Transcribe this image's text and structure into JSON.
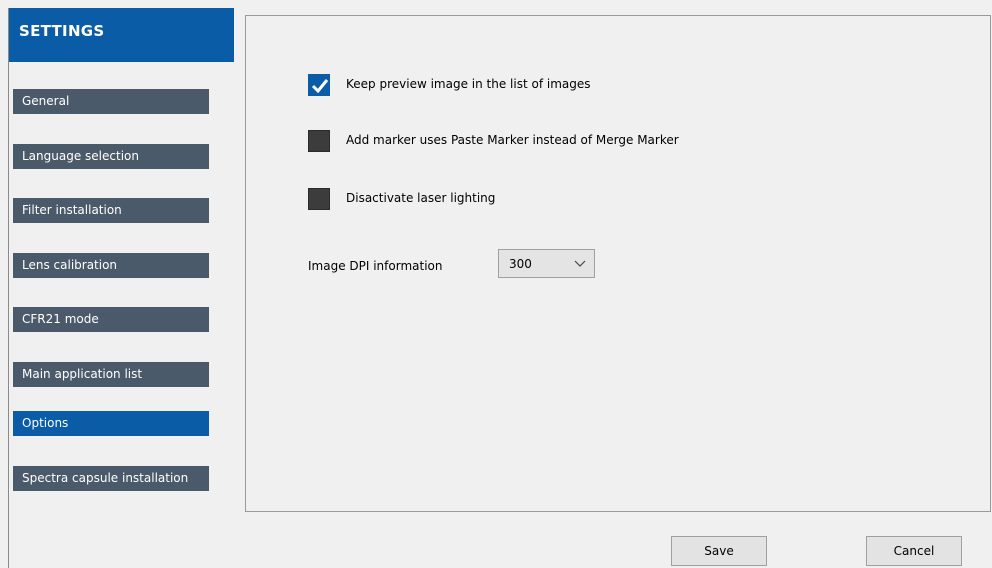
{
  "sidebar": {
    "title": "SETTINGS",
    "items": [
      {
        "label": "General"
      },
      {
        "label": "Language selection"
      },
      {
        "label": "Filter installation"
      },
      {
        "label": "Lens calibration"
      },
      {
        "label": "CFR21 mode"
      },
      {
        "label": "Main application list"
      },
      {
        "label": "Options"
      },
      {
        "label": "Spectra capsule installation"
      }
    ],
    "active_item": "Options"
  },
  "options": {
    "keep_preview": {
      "label": "Keep preview image in the list of images",
      "checked": true
    },
    "paste_marker": {
      "label": "Add marker uses Paste Marker instead of Merge Marker",
      "checked": false
    },
    "disable_laser": {
      "label": "Disactivate laser lighting",
      "checked": false
    },
    "dpi": {
      "label": "Image DPI information",
      "value": "300"
    }
  },
  "footer": {
    "save_label": "Save",
    "cancel_label": "Cancel"
  },
  "colors": {
    "accent": "#0a5ca6",
    "nav_item": "#4b5a6a",
    "checkbox_unchecked": "#3c3c3c"
  },
  "icons": {
    "checkmark": "checkmark-icon",
    "dropdown": "chevron-down-icon"
  }
}
